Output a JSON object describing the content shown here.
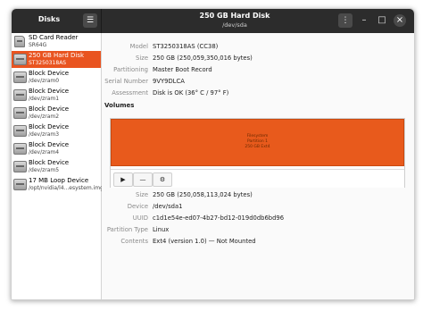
{
  "header": {
    "app_title": "Disks",
    "window_title": "250 GB Hard Disk",
    "window_subtitle": "/dev/sda"
  },
  "sidebar": {
    "devices": [
      {
        "name": "SD Card Reader",
        "sub": "SR64G",
        "icon": "sd-card-icon"
      },
      {
        "name": "250 GB Hard Disk",
        "sub": "ST3250318AS",
        "icon": "hard-disk-icon"
      },
      {
        "name": "Block Device",
        "sub": "/dev/zram0",
        "icon": "block-device-icon"
      },
      {
        "name": "Block Device",
        "sub": "/dev/zram1",
        "icon": "block-device-icon"
      },
      {
        "name": "Block Device",
        "sub": "/dev/zram2",
        "icon": "block-device-icon"
      },
      {
        "name": "Block Device",
        "sub": "/dev/zram3",
        "icon": "block-device-icon"
      },
      {
        "name": "Block Device",
        "sub": "/dev/zram4",
        "icon": "block-device-icon"
      },
      {
        "name": "Block Device",
        "sub": "/dev/zram5",
        "icon": "block-device-icon"
      },
      {
        "name": "17 MB Loop Device",
        "sub": "/opt/nvidia/l4...esystem.img",
        "icon": "loop-device-icon"
      }
    ],
    "selected_index": 1
  },
  "disk_info": [
    {
      "label": "Model",
      "value": "ST3250318AS (CC38)"
    },
    {
      "label": "Size",
      "value": "250 GB (250,059,350,016 bytes)"
    },
    {
      "label": "Partitioning",
      "value": "Master Boot Record"
    },
    {
      "label": "Serial Number",
      "value": "9VY9DLCA"
    },
    {
      "label": "Assessment",
      "value": "Disk is OK (36° C / 97° F)"
    }
  ],
  "volumes": {
    "heading": "Volumes",
    "partition_lines": [
      "Filesystem",
      "Partition 1",
      "250 GB Ext4"
    ],
    "partition_color": "#e85a1c",
    "toolbar": {
      "play": "▶",
      "minus": "—",
      "settings": "⚙"
    }
  },
  "partition_info": [
    {
      "label": "Size",
      "value": "250 GB (250,058,113,024 bytes)"
    },
    {
      "label": "Device",
      "value": "/dev/sda1"
    },
    {
      "label": "UUID",
      "value": "c1d1e54e-ed07-4b27-bd12-019d0db6bd96"
    },
    {
      "label": "Partition Type",
      "value": "Linux"
    },
    {
      "label": "Contents",
      "value": "Ext4 (version 1.0) — Not Mounted"
    }
  ],
  "colors": {
    "accent": "#e95420",
    "header_bg": "#2c2c2c"
  }
}
